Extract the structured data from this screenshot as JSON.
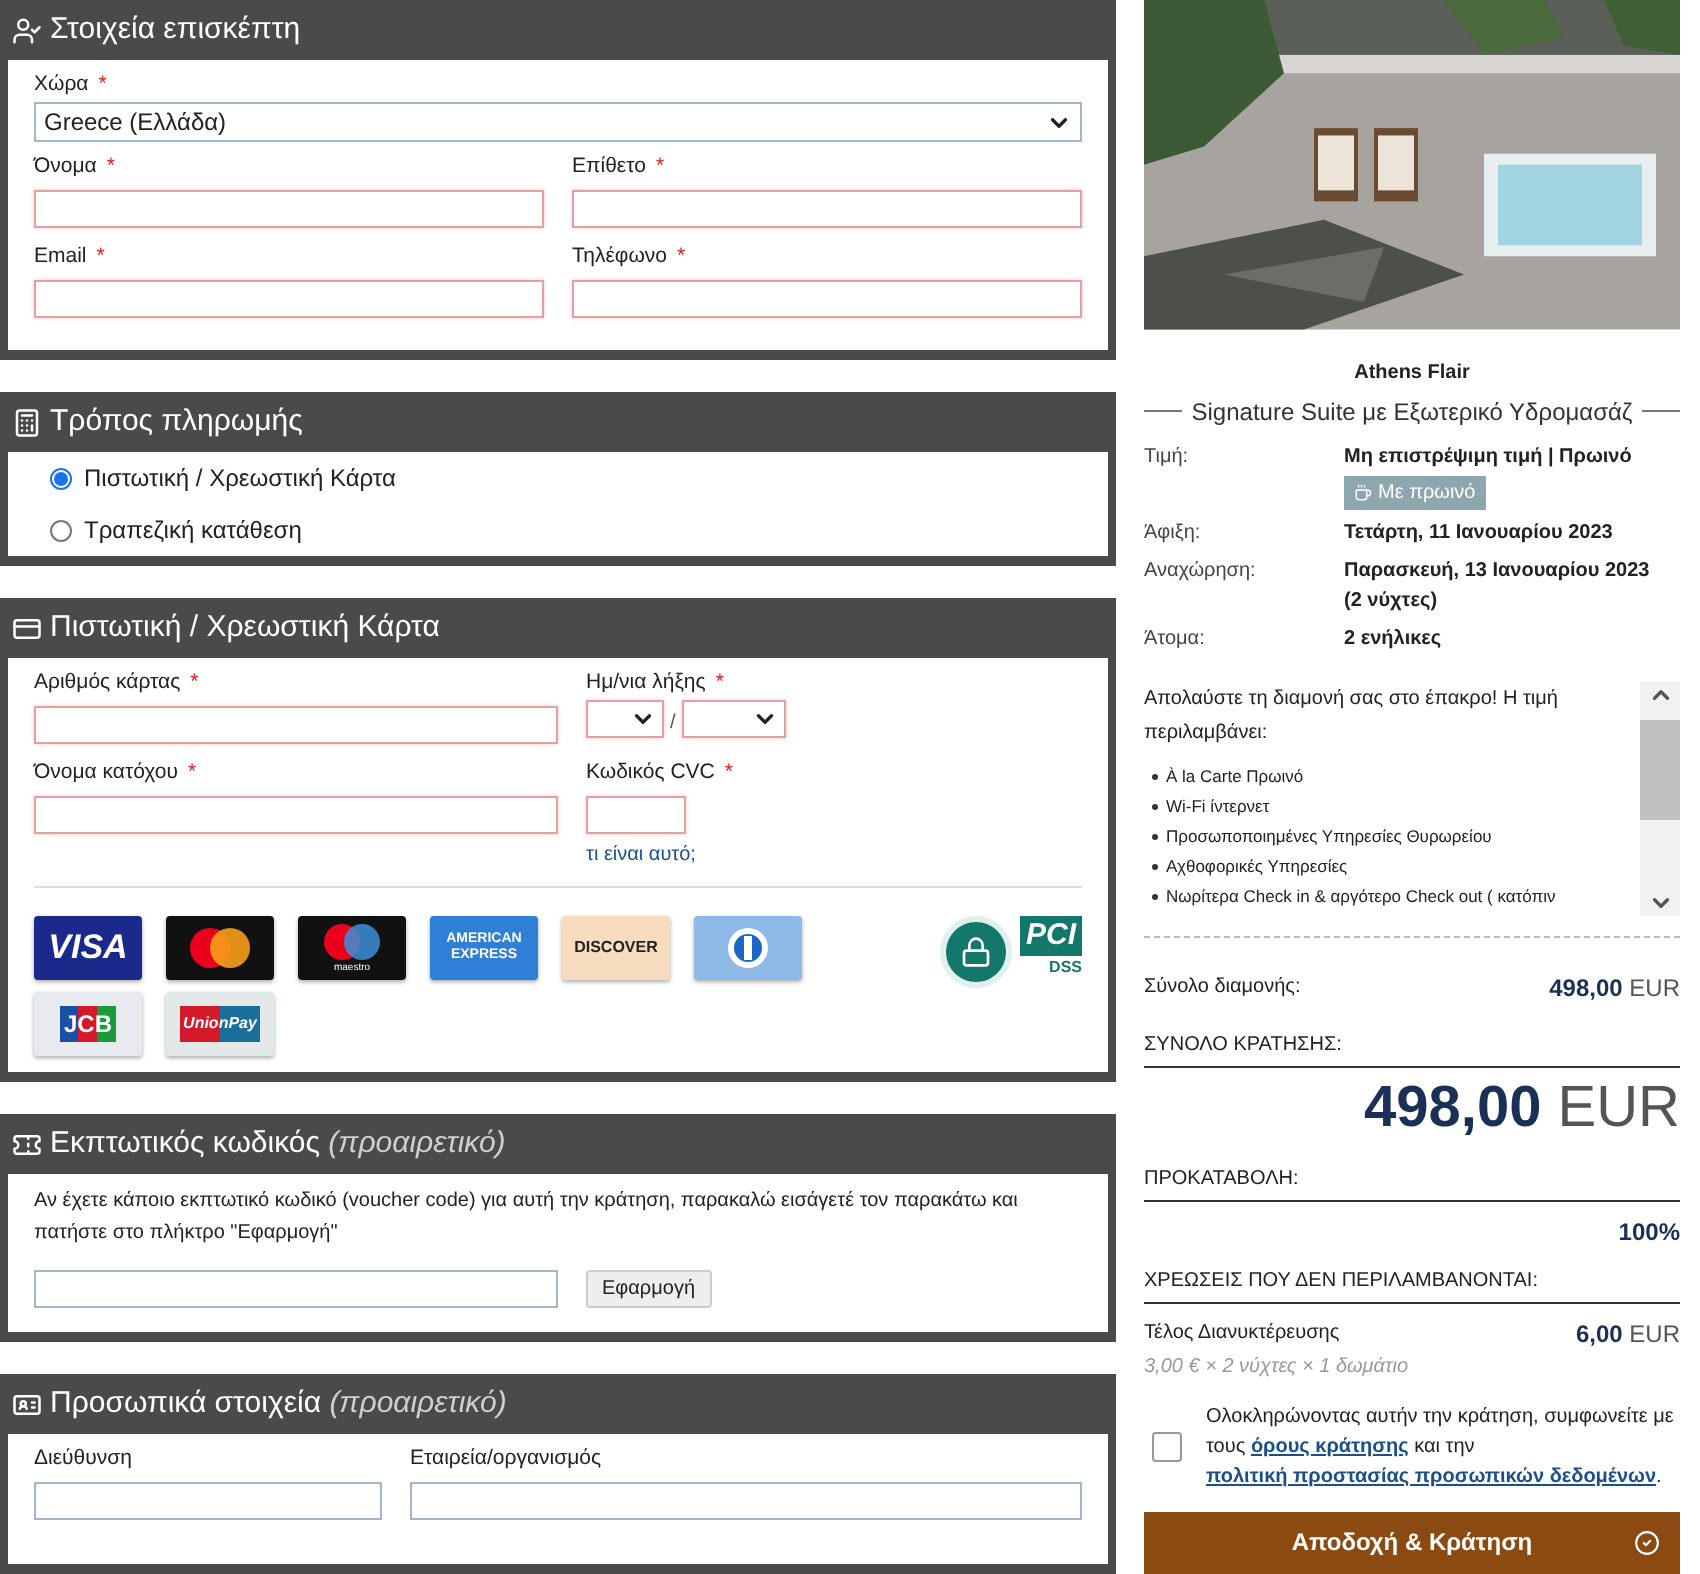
{
  "guest": {
    "title": "Στοιχεία επισκέπτη",
    "country": {
      "label": "Χώρα",
      "mark": "*",
      "value": "Greece (Ελλάδα)",
      "invalid": false
    },
    "fields": [
      {
        "label": "Όνομα",
        "mark": "*",
        "invalid": true
      },
      {
        "label": "Επίθετο",
        "mark": "*",
        "invalid": true
      },
      {
        "label": "Email",
        "mark": "*",
        "invalid": true
      },
      {
        "label": "Τηλέφωνο",
        "mark": "*",
        "invalid": true
      }
    ]
  },
  "payment": {
    "title": "Τρόπος πληρωμής",
    "options": [
      {
        "label": "Πιστωτική / Χρεωστική Κάρτα",
        "selected": true
      },
      {
        "label": "Τραπεζική κατάθεση",
        "selected": false
      }
    ]
  },
  "card": {
    "title": "Πιστωτική / Χρεωστική Κάρτα",
    "number": {
      "label": "Αριθμός κάρτας",
      "mark": "*",
      "invalid": true
    },
    "expiry": {
      "label": "Ημ/νια λήξης",
      "mark": "*",
      "invalid": true,
      "separator": "/"
    },
    "holder": {
      "label": "Όνομα κατόχου",
      "mark": "*",
      "invalid": true
    },
    "cvc": {
      "label": "Κωδικός CVC",
      "mark": "*",
      "invalid": true,
      "help_link": "τι είναι αυτό;"
    },
    "brands": [
      {
        "kind": "visa",
        "label": "VISA"
      },
      {
        "kind": "mastercard"
      },
      {
        "kind": "maestro",
        "label": "maestro"
      },
      {
        "kind": "amex",
        "label": "AMERICAN EXPRESS"
      },
      {
        "kind": "discover",
        "label": "DISCOVER"
      },
      {
        "kind": "diners"
      },
      {
        "kind": "jcb",
        "label": "JCB"
      },
      {
        "kind": "unionpay",
        "label": "UnionPay"
      }
    ],
    "pci": {
      "label": "PCI",
      "sub": "DSS"
    }
  },
  "voucher": {
    "title": "Εκπτωτικός κωδικός",
    "optional": "(προαιρετικό)",
    "text": "Αν έχετε κάποιο εκπτωτικό κωδικό (voucher code) για αυτή την κράτηση, παρακαλώ εισάγετέ τον παρακάτω και πατήστε στο πλήκτρο \"Εφαρμογή\"",
    "button": "Εφαρμογή"
  },
  "personal": {
    "title": "Προσωπικά στοιχεία",
    "optional": "(προαιρετικό)",
    "fields": [
      {
        "label": "Διεύθυνση"
      },
      {
        "label": "Εταιρεία/οργανισμός"
      }
    ]
  },
  "summary": {
    "hotel": "Athens Flair",
    "room": "Signature Suite με Εξωτερικό Υδρομασάζ",
    "rows": [
      {
        "label": "Τιμή:",
        "value": "Μη επιστρέψιμη τιμή | Πρωινό",
        "badge": "Με πρωινό"
      },
      {
        "label": "Άφιξη:",
        "value": "Τετάρτη, 11 Ιανουαρίου 2023"
      },
      {
        "label": "Αναχώρηση:",
        "value": "Παρασκευή, 13 Ιανουαρίου 2023 (2 νύχτες)"
      },
      {
        "label": "Άτομα:",
        "value": "2 ενήλικες"
      }
    ],
    "description": "Απολαύστε τη διαμονή σας στο έπακρο! Η τιμή περιλαμβάνει:",
    "includes": [
      "À la Carte Πρωινό",
      "Wi-Fi ίντερνετ",
      "Προσωποποιημένες Υπηρεσίες Θυρωρείου",
      "Αχθοφορικές Υπηρεσίες",
      "Νωρίτερα Check in & αργότερο Check out ( κατόπιν"
    ],
    "stay_label": "Σύνολο διαμονής:",
    "stay_amount": "498,00",
    "stay_currency": "EUR",
    "total_label": "ΣΥΝΟΛΟ ΚΡΑΤΗΣΗΣ:",
    "total_amount": "498,00",
    "total_currency": "EUR",
    "deposit_label": "ΠΡΟΚΑΤΑΒΟΛΗ:",
    "deposit_value": "100%",
    "extras_label": "ΧΡΕΩΣΕΙΣ ΠΟΥ ΔΕΝ ΠΕΡΙΛΑΜΒΑΝΟΝΤΑΙ:",
    "fee_label": "Τέλος Διανυκτέρευσης",
    "fee_amount": "6,00",
    "fee_currency": "EUR",
    "fee_detail": "3,00 € × 2 νύχτες × 1 δωμάτιο",
    "terms": {
      "checked": false,
      "before": "Ολοκληρώνοντας αυτήν την κράτηση, συμφωνείτε με τους",
      "link1": "όρους κράτησης",
      "middle": "και την",
      "link2": "πολιτική προστασίας προσωπικών δεδομένων",
      "after": "."
    },
    "submit": "Αποδοχή & Κράτηση"
  }
}
